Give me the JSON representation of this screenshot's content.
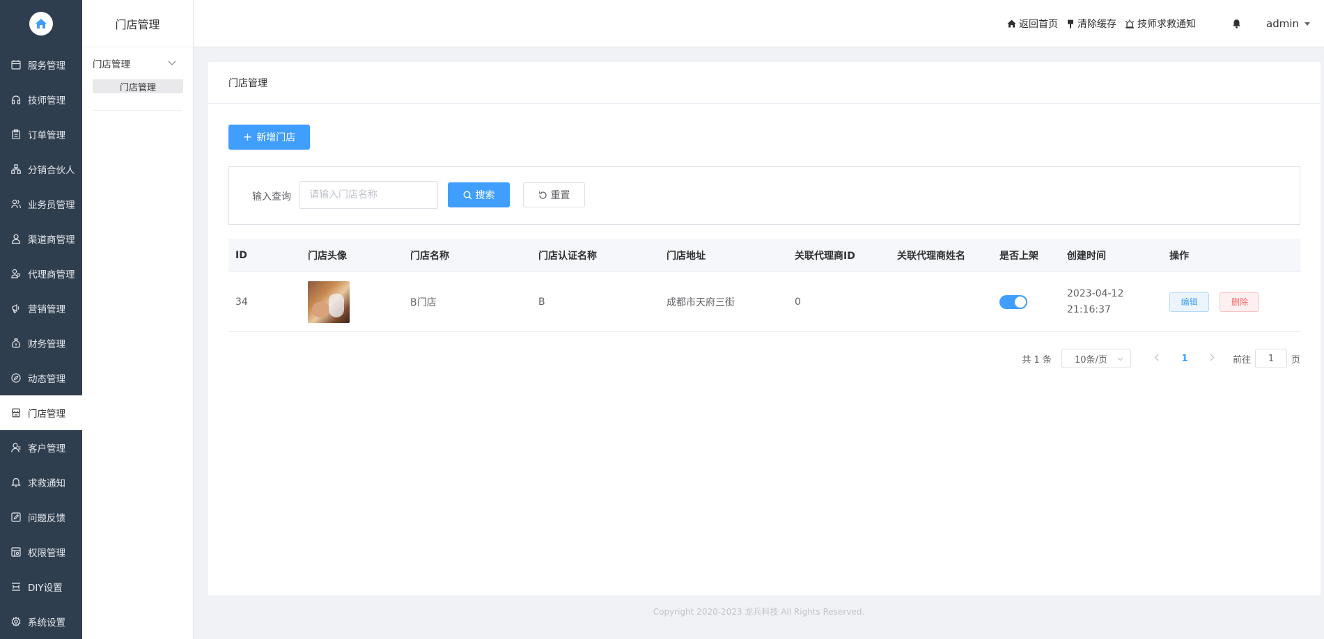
{
  "rail": {
    "items": [
      {
        "label": "服务管理",
        "icon": "calendar-icon"
      },
      {
        "label": "技师管理",
        "icon": "headset-icon"
      },
      {
        "label": "订单管理",
        "icon": "clipboard-icon"
      },
      {
        "label": "分销合伙人",
        "icon": "network-icon"
      },
      {
        "label": "业务员管理",
        "icon": "users-icon"
      },
      {
        "label": "渠道商管理",
        "icon": "user-icon"
      },
      {
        "label": "代理商管理",
        "icon": "user-group-icon"
      },
      {
        "label": "营销管理",
        "icon": "megaphone-icon"
      },
      {
        "label": "财务管理",
        "icon": "money-bag-icon"
      },
      {
        "label": "动态管理",
        "icon": "compass-icon"
      },
      {
        "label": "门店管理",
        "icon": "store-icon"
      },
      {
        "label": "客户管理",
        "icon": "customer-icon"
      },
      {
        "label": "求救通知",
        "icon": "bell-icon"
      },
      {
        "label": "问题反馈",
        "icon": "feedback-icon"
      },
      {
        "label": "权限管理",
        "icon": "permission-icon"
      },
      {
        "label": "DIY设置",
        "icon": "diy-icon"
      },
      {
        "label": "系统设置",
        "icon": "gear-icon"
      }
    ],
    "active_index": 10
  },
  "sub_sidebar": {
    "title": "门店管理",
    "group_label": "门店管理",
    "leaf_label": "门店管理"
  },
  "header": {
    "links": [
      {
        "label": "返回首页",
        "icon": "home-icon"
      },
      {
        "label": "清除缓存",
        "icon": "brush-icon"
      },
      {
        "label": "技师求救通知",
        "icon": "alarm-icon"
      }
    ],
    "user": "admin"
  },
  "page": {
    "breadcrumb": "门店管理",
    "add_button": "新增门店",
    "search": {
      "label": "输入查询",
      "placeholder": "请输入门店名称",
      "value": "",
      "search_button": "搜索",
      "reset_button": "重置"
    }
  },
  "table": {
    "columns": [
      "ID",
      "门店头像",
      "门店名称",
      "门店认证名称",
      "门店地址",
      "关联代理商ID",
      "关联代理商姓名",
      "是否上架",
      "创建时间",
      "操作"
    ],
    "rows": [
      {
        "id": "34",
        "name": "B门店",
        "cert_name": "B",
        "address": "成都市天府三街",
        "agent_id": "0",
        "agent_name": "",
        "on_shelf": true,
        "created_date": "2023-04-12",
        "created_time": "21:16:37",
        "edit_label": "编辑",
        "delete_label": "删除"
      }
    ]
  },
  "pagination": {
    "total_text": "共 1 条",
    "page_size": "10条/页",
    "current_page": "1",
    "goto_prefix": "前往",
    "goto_value": "1",
    "goto_suffix": "页"
  },
  "footer": {
    "copyright": "Copyright 2020-2023 龙兵科技 All Rights Reserved."
  },
  "colors": {
    "rail_bg": "#2f3e4e",
    "primary": "#409eff",
    "danger": "#f56c6c"
  }
}
